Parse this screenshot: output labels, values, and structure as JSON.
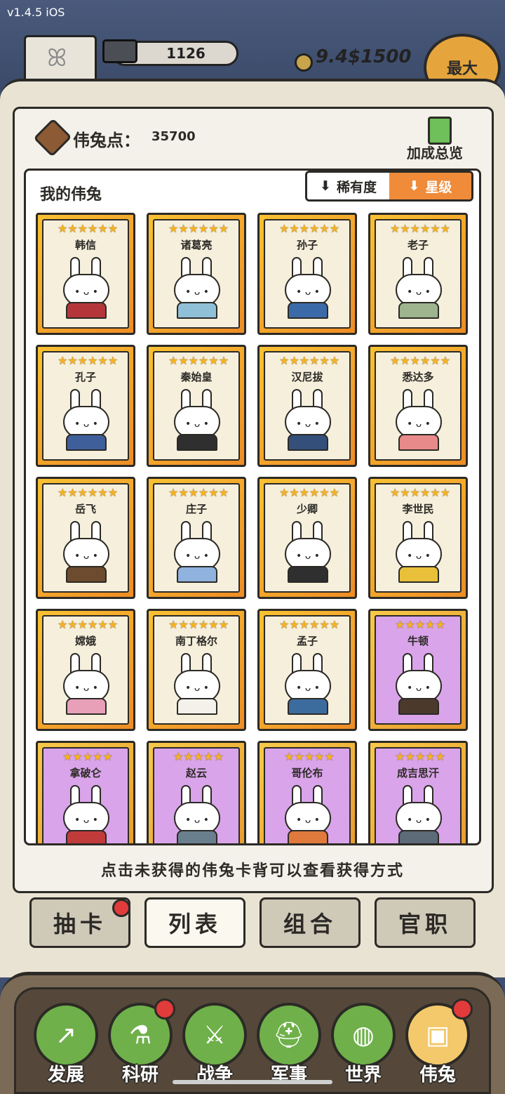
{
  "status": {
    "version": "v1.4.5 iOS"
  },
  "header": {
    "ingots": "1126",
    "money": "9.4$1500",
    "max_label": "最大"
  },
  "points": {
    "label": "伟兔点：",
    "value": "35700"
  },
  "bonus": {
    "label": "加成总览"
  },
  "list": {
    "title": "我的伟兔",
    "sort_rarity": "稀有度",
    "sort_star": "星级"
  },
  "cards": [
    {
      "name": "韩信",
      "stars": "★★★★★★",
      "body": "#b4363a"
    },
    {
      "name": "诸葛亮",
      "stars": "★★★★★★",
      "body": "#8fc0d8"
    },
    {
      "name": "孙子",
      "stars": "★★★★★★",
      "body": "#3b6aa8"
    },
    {
      "name": "老子",
      "stars": "★★★★★★",
      "body": "#9db48f"
    },
    {
      "name": "孔子",
      "stars": "★★★★★★",
      "body": "#3f5f9a"
    },
    {
      "name": "秦始皇",
      "stars": "★★★★★★",
      "body": "#2f2f2f"
    },
    {
      "name": "汉尼拔",
      "stars": "★★★★★★",
      "body": "#34507a"
    },
    {
      "name": "悉达多",
      "stars": "★★★★★★",
      "body": "#e98a8a"
    },
    {
      "name": "岳飞",
      "stars": "★★★★★★",
      "body": "#6d4b2e"
    },
    {
      "name": "庄子",
      "stars": "★★★★★★",
      "body": "#8fb2df"
    },
    {
      "name": "少卿",
      "stars": "★★★★★★",
      "body": "#2f2f2f"
    },
    {
      "name": "李世民",
      "stars": "★★★★★★",
      "body": "#e8c03a"
    },
    {
      "name": "嫦娥",
      "stars": "★★★★★★",
      "body": "#e7a0b8"
    },
    {
      "name": "南丁格尔",
      "stars": "★★★★★★",
      "body": "#f3f1ea"
    },
    {
      "name": "孟子",
      "stars": "★★★★★★",
      "body": "#3c6b9e"
    },
    {
      "name": "牛顿",
      "stars": "★★★★★",
      "body": "#4b3a2c",
      "purple": true
    },
    {
      "name": "拿破仑",
      "stars": "★★★★★",
      "body": "#c23b3b",
      "purple": true
    },
    {
      "name": "赵云",
      "stars": "★★★★★",
      "body": "#6a7f8e",
      "purple": true
    },
    {
      "name": "哥伦布",
      "stars": "★★★★★",
      "body": "#e07a3c",
      "purple": true
    },
    {
      "name": "成吉思汗",
      "stars": "★★★★★",
      "body": "#5d6a77",
      "purple": true
    }
  ],
  "hint": "点击未获得的伟兔卡背可以查看获得方式",
  "tabs": [
    "抽卡",
    "列表",
    "组合",
    "官职"
  ],
  "nav": [
    {
      "label": "发展",
      "icon": "growth-icon",
      "glyph": "↗"
    },
    {
      "label": "科研",
      "icon": "flask-icon",
      "glyph": "⚗"
    },
    {
      "label": "战争",
      "icon": "swords-icon",
      "glyph": "⚔"
    },
    {
      "label": "军事",
      "icon": "helmet-icon",
      "glyph": "⛑"
    },
    {
      "label": "世界",
      "icon": "globe-icon",
      "glyph": "◍"
    },
    {
      "label": "伟兔",
      "icon": "rabbit-card-icon",
      "glyph": "▣"
    }
  ]
}
